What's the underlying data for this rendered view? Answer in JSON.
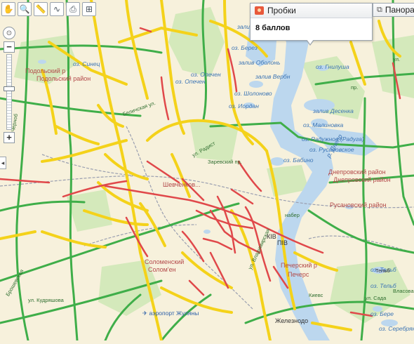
{
  "toolbar": {
    "icons": [
      "hand-icon",
      "zoom-area-icon",
      "ruler-icon",
      "route-icon",
      "print-icon",
      "layers-icon"
    ],
    "hand": "✋",
    "magnifier": "🔍",
    "ruler": "📏",
    "route": "∿",
    "print": "⎙",
    "layers": "⊞"
  },
  "zoom": {
    "plus": "+",
    "minus": "−",
    "level_fraction": 0.55
  },
  "traffic": {
    "title": "Пробки",
    "score": "8 баллов"
  },
  "panorama": {
    "title": "Панора"
  },
  "labels": {
    "podolsk1": "Подольский р",
    "podolsk2": "Подольский район",
    "shev": "Шевченков...",
    "dniepr1": "Днепровский район",
    "dniepr2": "Днепровский район",
    "rusan": "Русановский район",
    "solom1": "Соломенский",
    "solom2": "Солом'ен",
    "pecher1": "Печерский р",
    "pecher2": "Печерс",
    "airport": "аэропорт Жуляны",
    "zeleznod": "Железнодо",
    "oz_sinets": "оз. Синец",
    "oz_opech1": "оз. Опечен",
    "oz_opech2": "оз. Опечен",
    "oz_berez": "оз. Берез",
    "zal_obolon": "залив Оболонь",
    "zal_verbn": "залив Вербн",
    "oz_shol": "оз. Шолоново",
    "oz_iordan": "оз. Иордан",
    "oz_gnilusha": "оз. Гнилуша",
    "zal_desenka": "залив Десенка",
    "oz_malin": "оз. Малиновка",
    "oz_radug": "оз. Радужное (Радуга)",
    "oz_rusan": "оз. Русановское",
    "oz_babin": "оз. Бабино",
    "oz_telb": "оз. Тельб",
    "oz_bereg": "оз. Бере",
    "oz_serebr": "оз. Серебрян",
    "oz_right": "оз. Тельб",
    "zal": "залив",
    "rd_belich": "Беличская ул.",
    "rd_rad": "ул. Радист",
    "vul_vlad": "ул. Владимирская",
    "rd_kiev": "Киевс",
    "rd_zaryv": "Заревский пр.",
    "rd_chorno": "Черноб",
    "rd_brosh": "Брошевская",
    "rd_kudr": "ул. Кудряшова",
    "rd_vlasov": "Власова",
    "rd_ul": "ул.",
    "rd_ul2": "пр.",
    "tell": "Тельб",
    "piv": "ПІВ",
    "kiv": "КІВ",
    "naber": "набер",
    "vul": "ул. Сада"
  },
  "colors": {
    "jam": "#e0484a",
    "slow": "#f4d21a",
    "free": "#3fae49",
    "water": "#bcd7ee",
    "land": "#f7f1dc",
    "park": "#cfe6b4"
  }
}
